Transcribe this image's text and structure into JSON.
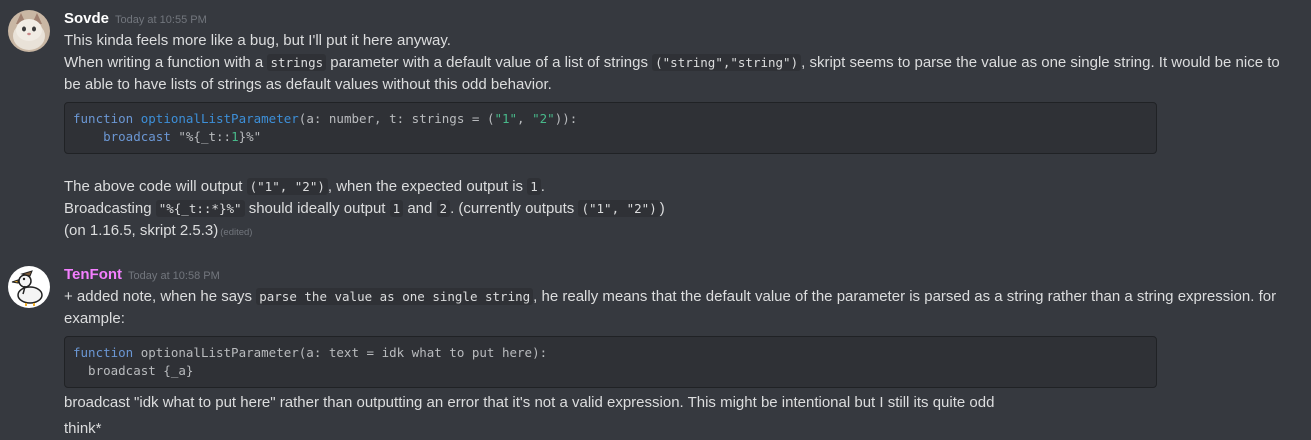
{
  "messages": [
    {
      "username": "Sovde",
      "username_color": "#ffffff",
      "timestamp": "Today at 10:55 PM",
      "line1": "This kinda feels more like a bug, but I'll put it here anyway.",
      "line2_a": "When writing a function with a ",
      "line2_code1": "strings",
      "line2_b": " parameter with a default value of a list of strings ",
      "line2_code2": "(\"string\",\"string\")",
      "line2_c": ", skript seems to parse the value as one single string. It would be nice to",
      "line3": "be able to have lists of strings as default values without this odd behavior.",
      "code": {
        "l1_kw": "function",
        "l1_fn": "optionalListParameter",
        "l1_a": "(a: number, t: strings = (",
        "l1_s1": "\"1\"",
        "l1_b": ", ",
        "l1_s2": "\"2\"",
        "l1_c": ")):",
        "l2_indent": "    ",
        "l2_kw": "broadcast",
        "l2_a": " \"%{_t::",
        "l2_num": "1",
        "l2_b": "}%\""
      },
      "p1_a": "The above code will output ",
      "p1_code1": "(\"1\", \"2\")",
      "p1_b": ", when the expected output is ",
      "p1_code2": "1",
      "p1_c": ".",
      "p2_a": "Broadcasting ",
      "p2_code1": "\"%{_t::*}%\"",
      "p2_b": " should ideally output ",
      "p2_code2": "1",
      "p2_c": " and ",
      "p2_code3": "2",
      "p2_d": ". (currently outputs ",
      "p2_code4": "(\"1\", \"2\")",
      "p2_e": ")",
      "p3": "(on 1.16.5, skript 2.5.3)",
      "edited": "(edited)"
    },
    {
      "username": "TenFont",
      "username_color": "#f47fff",
      "timestamp": "Today at 10:58 PM",
      "line1_a": "+ added note, when he says ",
      "line1_code": "parse the value as one single string",
      "line1_b": ", he really means that the default value of the parameter is parsed as a string rather than a string expression. for",
      "line2": "example:",
      "code": {
        "l1_kw": "function",
        "l1_rest": " optionalListParameter(a: text = idk what to put here):",
        "l2": "  broadcast {_a}"
      },
      "line3": " broadcast \"idk what to put here\" rather than outputting an error that it's not a valid expression. This might be intentional but I still its quite odd",
      "line4": "think*"
    }
  ]
}
